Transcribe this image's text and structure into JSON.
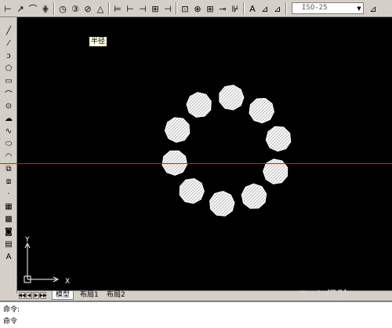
{
  "toolbar": {
    "dimstyle_value": "ISO-25",
    "icons": [
      "linear-dim",
      "aligned-dim",
      "arc-length-dim",
      "ordinate-dim",
      "radius-dim",
      "jogged-dim",
      "diameter-dim",
      "angular-dim",
      "quick-dim",
      "baseline-dim",
      "continue-dim",
      "space-dim",
      "break-dim",
      "tolerance-dim",
      "center-mark",
      "inspect-dim",
      "jogged-linear",
      "dimtedit",
      "dimedit",
      "dim-update"
    ]
  },
  "tooltip": {
    "text": "半径"
  },
  "left_toolbar": {
    "icons": [
      "line",
      "construction-line",
      "polyline",
      "polygon",
      "rectangle",
      "arc",
      "circle",
      "revision-cloud",
      "spline",
      "ellipse",
      "ellipse-arc",
      "insert-block",
      "make-block",
      "point",
      "hatch",
      "gradient",
      "region",
      "table",
      "multiline-text"
    ]
  },
  "ucs": {
    "x_label": "X",
    "y_label": "Y"
  },
  "tabs": [
    "模型",
    "布局1",
    "布局2"
  ],
  "command": {
    "prompt": "命令:",
    "prompt2": "命令"
  },
  "watermark": "Bai 经验",
  "colors": {
    "canvas": "#000000",
    "crosshair": "#e0141e",
    "objects": "#ffffff"
  }
}
